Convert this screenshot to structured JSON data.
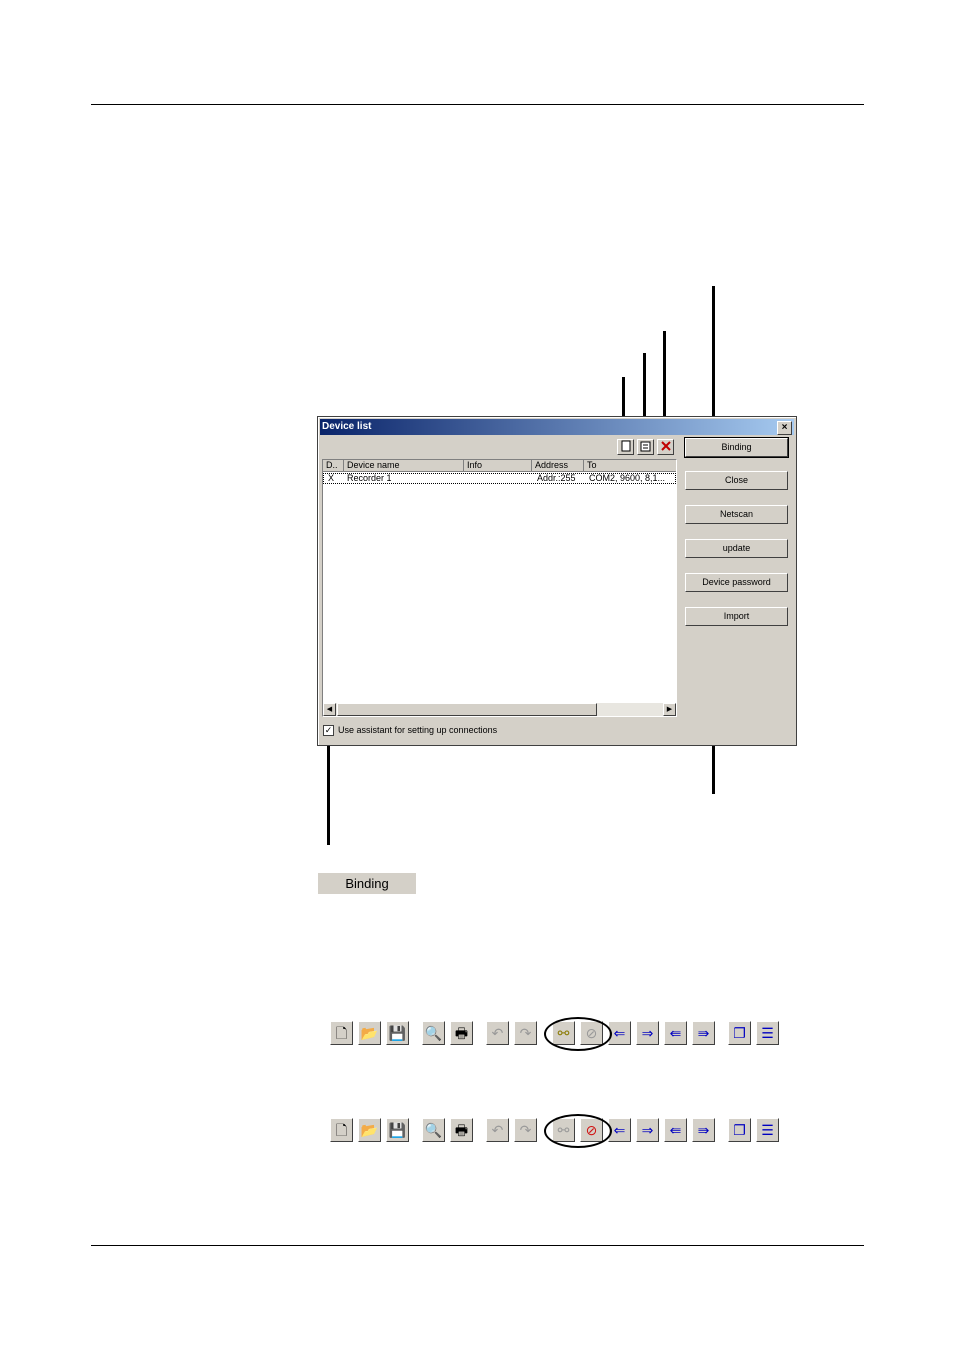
{
  "dialog": {
    "title": "Device list",
    "close_glyph": "×",
    "toolbar_icons": [
      "new-device-icon",
      "properties-icon",
      "delete-icon"
    ],
    "list": {
      "columns": [
        "D..",
        "Device name",
        "Info",
        "Address",
        "To"
      ],
      "rows": [
        {
          "d": "X",
          "name": "Recorder 1",
          "info": "",
          "address": "Addr.:255",
          "to": "COM2, 9600, 8,1..."
        }
      ]
    },
    "buttons": {
      "binding": "Binding",
      "close": "Close",
      "netscan": "Netscan",
      "update": "update",
      "device_password": "Device password",
      "import": "Import"
    },
    "assistant_checkbox": {
      "checked": true,
      "label": "Use assistant for setting up connections"
    }
  },
  "binding_sample": "Binding",
  "toolbars": [
    {
      "state": "connected",
      "icons": [
        "new-icon",
        "open-icon",
        "save-icon",
        "print-preview-icon",
        "print-icon",
        "undo-icon",
        "redo-icon",
        "connect-icon",
        "disconnect-icon",
        "import-left-icon",
        "import-right-icon",
        "export-left-icon",
        "export-right-icon",
        "cascade-icon",
        "tile-icon"
      ]
    },
    {
      "state": "disconnected",
      "icons": [
        "new-icon",
        "open-icon",
        "save-icon",
        "print-preview-icon",
        "print-icon",
        "undo-icon",
        "redo-icon",
        "connect-icon",
        "disconnect-icon",
        "import-left-icon",
        "import-right-icon",
        "export-left-icon",
        "export-right-icon",
        "cascade-icon",
        "tile-icon"
      ]
    }
  ]
}
